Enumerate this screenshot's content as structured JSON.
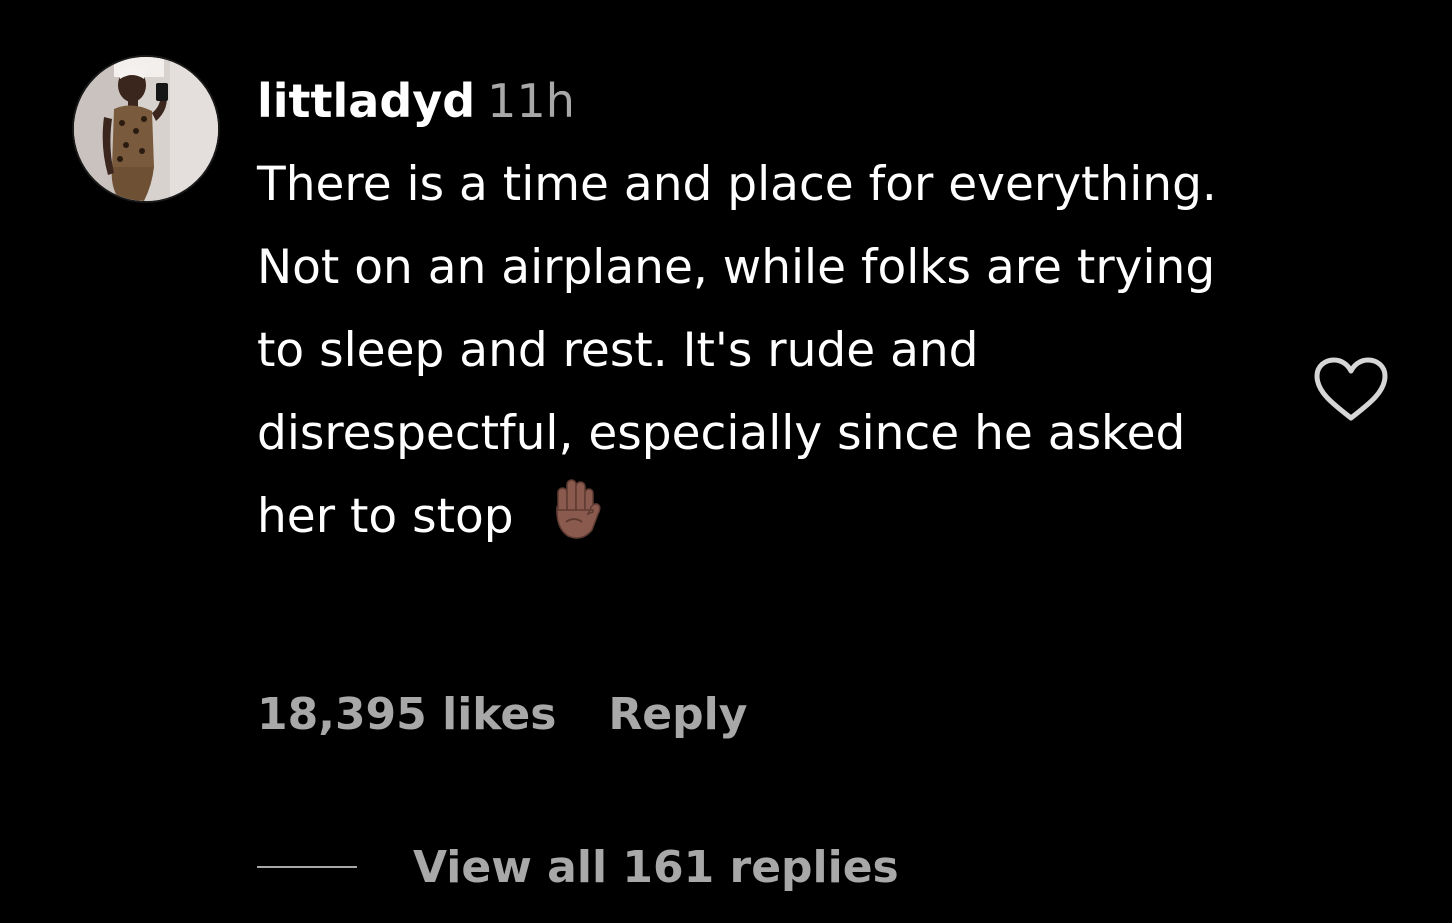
{
  "comment": {
    "username": "littladyd",
    "timestamp": "11h",
    "text": "There is a time and place for everything. Not on an airplane, while folks are trying to sleep and rest. It's rude and disrespectful, especially since he asked her to stop",
    "emoji": "raised-hand-emoji",
    "likes": "18,395 likes",
    "reply_label": "Reply",
    "view_replies": "View all 161 replies",
    "like_icon": "heart-icon",
    "colors": {
      "background": "#000000",
      "primary_text": "#ffffff",
      "secondary_text": "#a8a8a8",
      "emoji_skin": "#8a5a4e"
    }
  }
}
